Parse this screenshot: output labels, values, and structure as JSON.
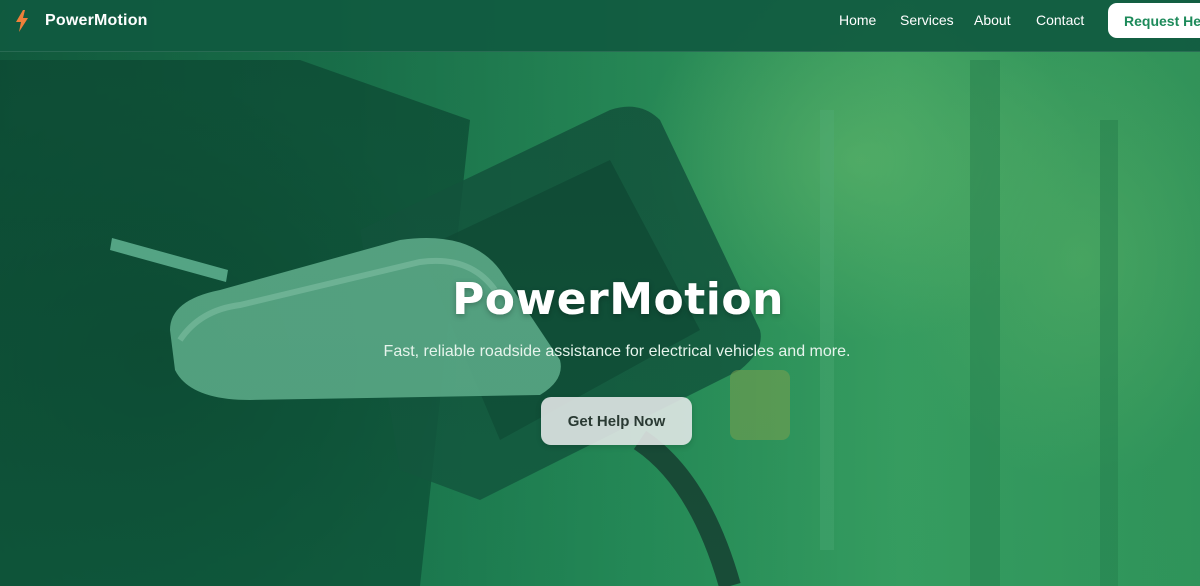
{
  "navbar": {
    "brand": {
      "icon": "lightning-bolt-icon",
      "name": "PowerMotion",
      "icon_color": "#f0803a"
    },
    "links": [
      "Home",
      "Services",
      "About",
      "Contact"
    ],
    "cta_label": "Request Help"
  },
  "hero": {
    "title": "PowerMotion",
    "subtitle": "Fast, reliable roadside assistance for electrical vehicles and more.",
    "button_label": "Get Help Now"
  },
  "colors": {
    "accent": "#1d8a5a",
    "overlay": "#1f7a52"
  }
}
